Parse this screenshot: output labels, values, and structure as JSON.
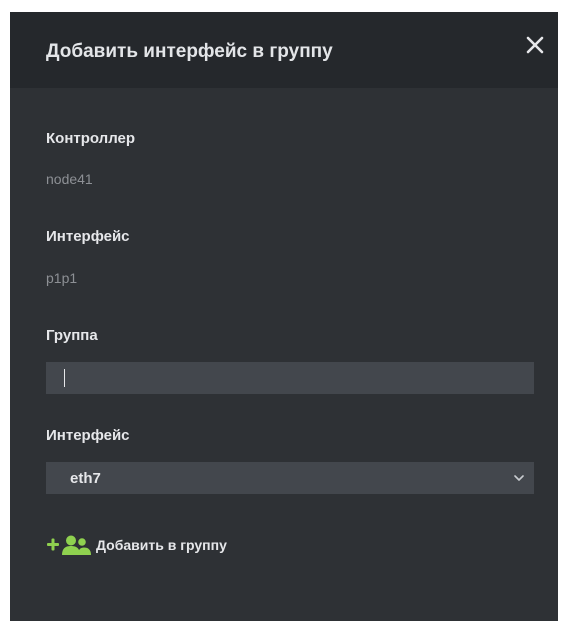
{
  "dialog": {
    "title": "Добавить интерфейс в группу",
    "close_icon": "close-icon"
  },
  "form": {
    "controller_label": "Контроллер",
    "controller_value": "node41",
    "interface_label": "Интерфейс",
    "interface_value": "p1p1",
    "group_label": "Группа",
    "group_value": "",
    "target_interface_label": "Интерфейс",
    "target_interface_selected": "eth7",
    "chevron_icon": "chevron-down-icon"
  },
  "actions": {
    "add_to_group_label": "Добавить в группу",
    "add_icon": "add-user-group-icon",
    "accent_color": "#8fd14f"
  },
  "colors": {
    "header_bg": "#25282c",
    "panel_bg": "#2e3135",
    "field_bg": "#43474d"
  }
}
